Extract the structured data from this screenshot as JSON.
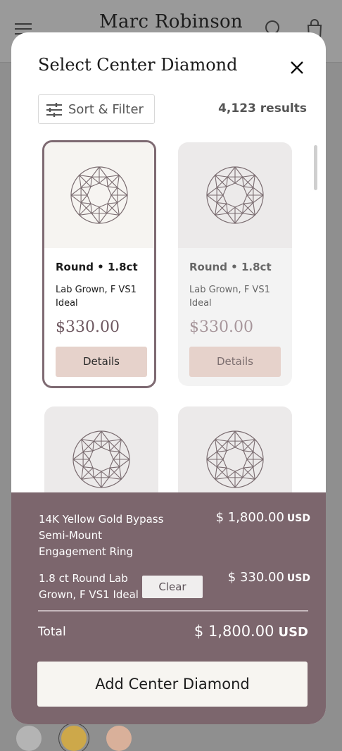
{
  "header": {
    "logo": "Marc Robinson",
    "icons": [
      "menu-icon",
      "search-icon",
      "shopping-bag-icon"
    ]
  },
  "modal": {
    "title": "Select Center Diamond",
    "close_icon": "close-icon",
    "sort_filter_label": "Sort & Filter",
    "sort_filter_icon": "sliders-icon",
    "results_count": "4,123 results",
    "cards": [
      {
        "title": "Round • 1.8ct",
        "desc": "Lab Grown, F VS1 Ideal",
        "price": "$330.00",
        "button": "Details",
        "selected": true
      },
      {
        "title": "Round • 1.8ct",
        "desc": "Lab Grown, F VS1 Ideal",
        "price": "$330.00",
        "button": "Details",
        "selected": false
      },
      {
        "title": "",
        "desc": "",
        "price": "",
        "button": "",
        "selected": false
      },
      {
        "title": "",
        "desc": "",
        "price": "",
        "button": "",
        "selected": false
      }
    ]
  },
  "summary": {
    "setting_name": "14K Yellow Gold Bypass Semi-Mount Engagement Ring",
    "setting_price": "$ 1,800.00",
    "setting_currency": "USD",
    "diamond_name": "1.8 ct Round Lab Grown, F VS1 Ideal",
    "clear_label": "Clear",
    "diamond_price": "$ 330.00",
    "diamond_currency": "USD",
    "total_label": "Total",
    "total_value": "$ 1,800.00",
    "total_currency": "USD",
    "add_button": "Add Center Diamond"
  },
  "colors": {
    "accent": "#7c666d",
    "button_tint": "#e6d2cb",
    "swatches": [
      "#b4b4b4",
      "#cda84a",
      "#d9b09a"
    ]
  }
}
